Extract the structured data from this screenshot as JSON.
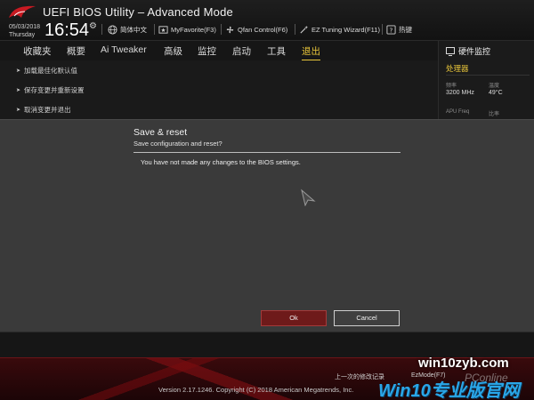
{
  "header": {
    "title": "UEFI BIOS Utility – Advanced Mode",
    "date": "05/03/2018",
    "day": "Thursday",
    "time": "16:54",
    "tools": [
      {
        "label": "简体中文",
        "icon": "globe-icon"
      },
      {
        "label": "MyFavorite(F3)",
        "icon": "favorite-icon"
      },
      {
        "label": "Qfan Control(F6)",
        "icon": "fan-icon"
      },
      {
        "label": "EZ Tuning Wizard(F11)",
        "icon": "wand-icon"
      },
      {
        "label": "热键",
        "icon": "help-icon"
      }
    ]
  },
  "nav": {
    "tabs": [
      "收藏夹",
      "概要",
      "Ai Tweaker",
      "高级",
      "监控",
      "启动",
      "工具",
      "退出"
    ],
    "active": "退出"
  },
  "exit_menu": {
    "items": [
      "加载最佳化默认值",
      "保存变更并重新设置",
      "取消变更并退出"
    ]
  },
  "hardware_monitor": {
    "title": "硬件监控",
    "section": "处理器",
    "freq_label": "频率",
    "freq_value": "3200 MHz",
    "temp_label": "温度",
    "temp_value": "49°C",
    "apu_label": "APU Freq",
    "ratio_label": "比率"
  },
  "dialog": {
    "title": "Save & reset",
    "subtitle": "Save configuration and reset?",
    "message": "You have not made any changes to the BIOS settings.",
    "ok_label": "Ok",
    "cancel_label": "Cancel"
  },
  "footer": {
    "last_modified": "上一次的修改记录",
    "ezmode": "EzMode(F7)",
    "version": "Version 2.17.1246. Copyright (C) 2018 American Megatrends, Inc."
  },
  "watermarks": {
    "site": "win10zyb.com",
    "pconline": "PConline",
    "win10": "Win10专业版官网"
  },
  "colors": {
    "accent": "#e8c53a",
    "ok_button": "#6e1a1a",
    "footer_red": "#3a0a0c",
    "watermark_blue": "#2aa6e8"
  }
}
